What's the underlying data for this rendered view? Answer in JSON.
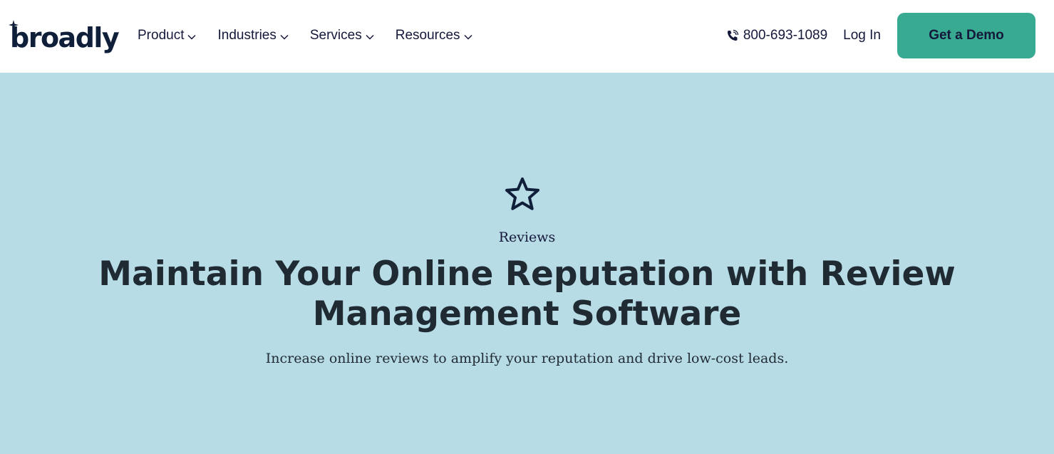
{
  "header": {
    "logo_text": "broadly",
    "nav": [
      {
        "label": "Product"
      },
      {
        "label": "Industries"
      },
      {
        "label": "Services"
      },
      {
        "label": "Resources"
      }
    ],
    "phone": "800-693-1089",
    "login_label": "Log In",
    "demo_label": "Get a Demo"
  },
  "hero": {
    "icon": "star-icon",
    "eyebrow": "Reviews",
    "headline_line1": "Maintain Your Online Reputation with Review",
    "headline_line2": "Management Software",
    "subheading": "Increase online reviews to amplify your reputation and drive low-cost leads."
  },
  "colors": {
    "header_bg": "#ffffff",
    "hero_bg": "#b8dce6",
    "accent": "#38aa91",
    "text_dark": "#14183a",
    "headline": "#1f2a33"
  }
}
